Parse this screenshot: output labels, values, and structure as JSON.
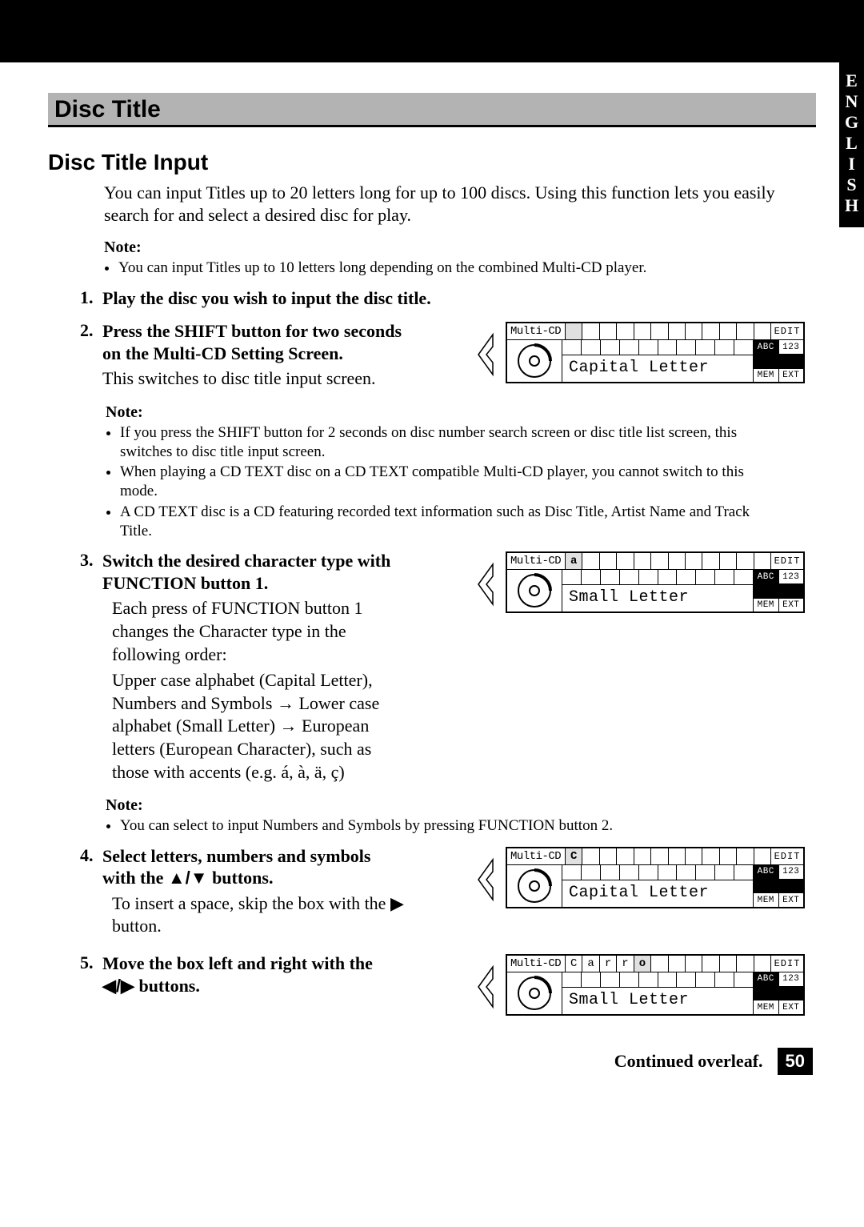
{
  "language_tab": "ENGLISH",
  "section_title": "Disc Title",
  "subsection_title": "Disc Title Input",
  "intro": "You can input Titles up to 20 letters long for up to 100 discs. Using this function lets you easily search for and select a desired disc for play.",
  "note": "Note:",
  "note_intro_items": [
    "You can input Titles up to 10 letters long depending on the combined Multi-CD player."
  ],
  "step1": "Play the disc you wish to input the disc title.",
  "step2_bold": "Press the SHIFT button for two seconds on the Multi-CD Setting Screen.",
  "step2_text": "This switches to disc title input screen.",
  "note2_items": [
    "If you press the SHIFT button for 2 seconds on disc number search screen or disc title list screen, this switches to disc title input screen.",
    "When playing a CD TEXT disc on a CD TEXT compatible Multi-CD player, you cannot switch to this mode.",
    "A CD TEXT disc is a CD featuring  recorded text information such as Disc Title, Artist Name and Track Title."
  ],
  "step3_bold": "Switch the desired character type with FUNCTION button 1.",
  "step3_text_a": "Each press of FUNCTION button 1 changes the Character type in the following order:",
  "step3_text_b": "Upper case alphabet (Capital Letter), Numbers and Symbols → Lower case alphabet (Small Letter) → European letters (European Character), such as those with accents (e.g. á, à, ä, ç)",
  "note3_items": [
    "You can select to input Numbers and Symbols by pressing FUNCTION button 2."
  ],
  "step4_bold_pre": "Select letters, numbers and symbols with the ",
  "step4_bold_post": " buttons.",
  "step4_text_a": "To insert a space, skip the box with the ",
  "step4_text_b": " button.",
  "step5_bold_pre": "Move the box left and right with the ",
  "step5_bold_post": " buttons.",
  "lcd": {
    "label": "Multi-CD",
    "edit": "EDIT",
    "abc": "ABC",
    "n123": "123",
    "mem": "MEM",
    "ext": "EXT"
  },
  "lcd1_chars": [
    "",
    "",
    "",
    "",
    "",
    "",
    "",
    "",
    "",
    "",
    "",
    ""
  ],
  "lcd1_status": "Capital Letter",
  "lcd2_chars": [
    "a",
    "",
    "",
    "",
    "",
    "",
    "",
    "",
    "",
    "",
    "",
    ""
  ],
  "lcd2_status": "Small Letter",
  "lcd3_chars": [
    "C",
    "",
    "",
    "",
    "",
    "",
    "",
    "",
    "",
    "",
    "",
    ""
  ],
  "lcd3_status": "Capital Letter",
  "lcd4_chars": [
    "C",
    "a",
    "r",
    "r",
    "o",
    "",
    "",
    "",
    "",
    "",
    "",
    ""
  ],
  "lcd4_status": "Small Letter",
  "continued": "Continued overleaf.",
  "page_number": "50"
}
